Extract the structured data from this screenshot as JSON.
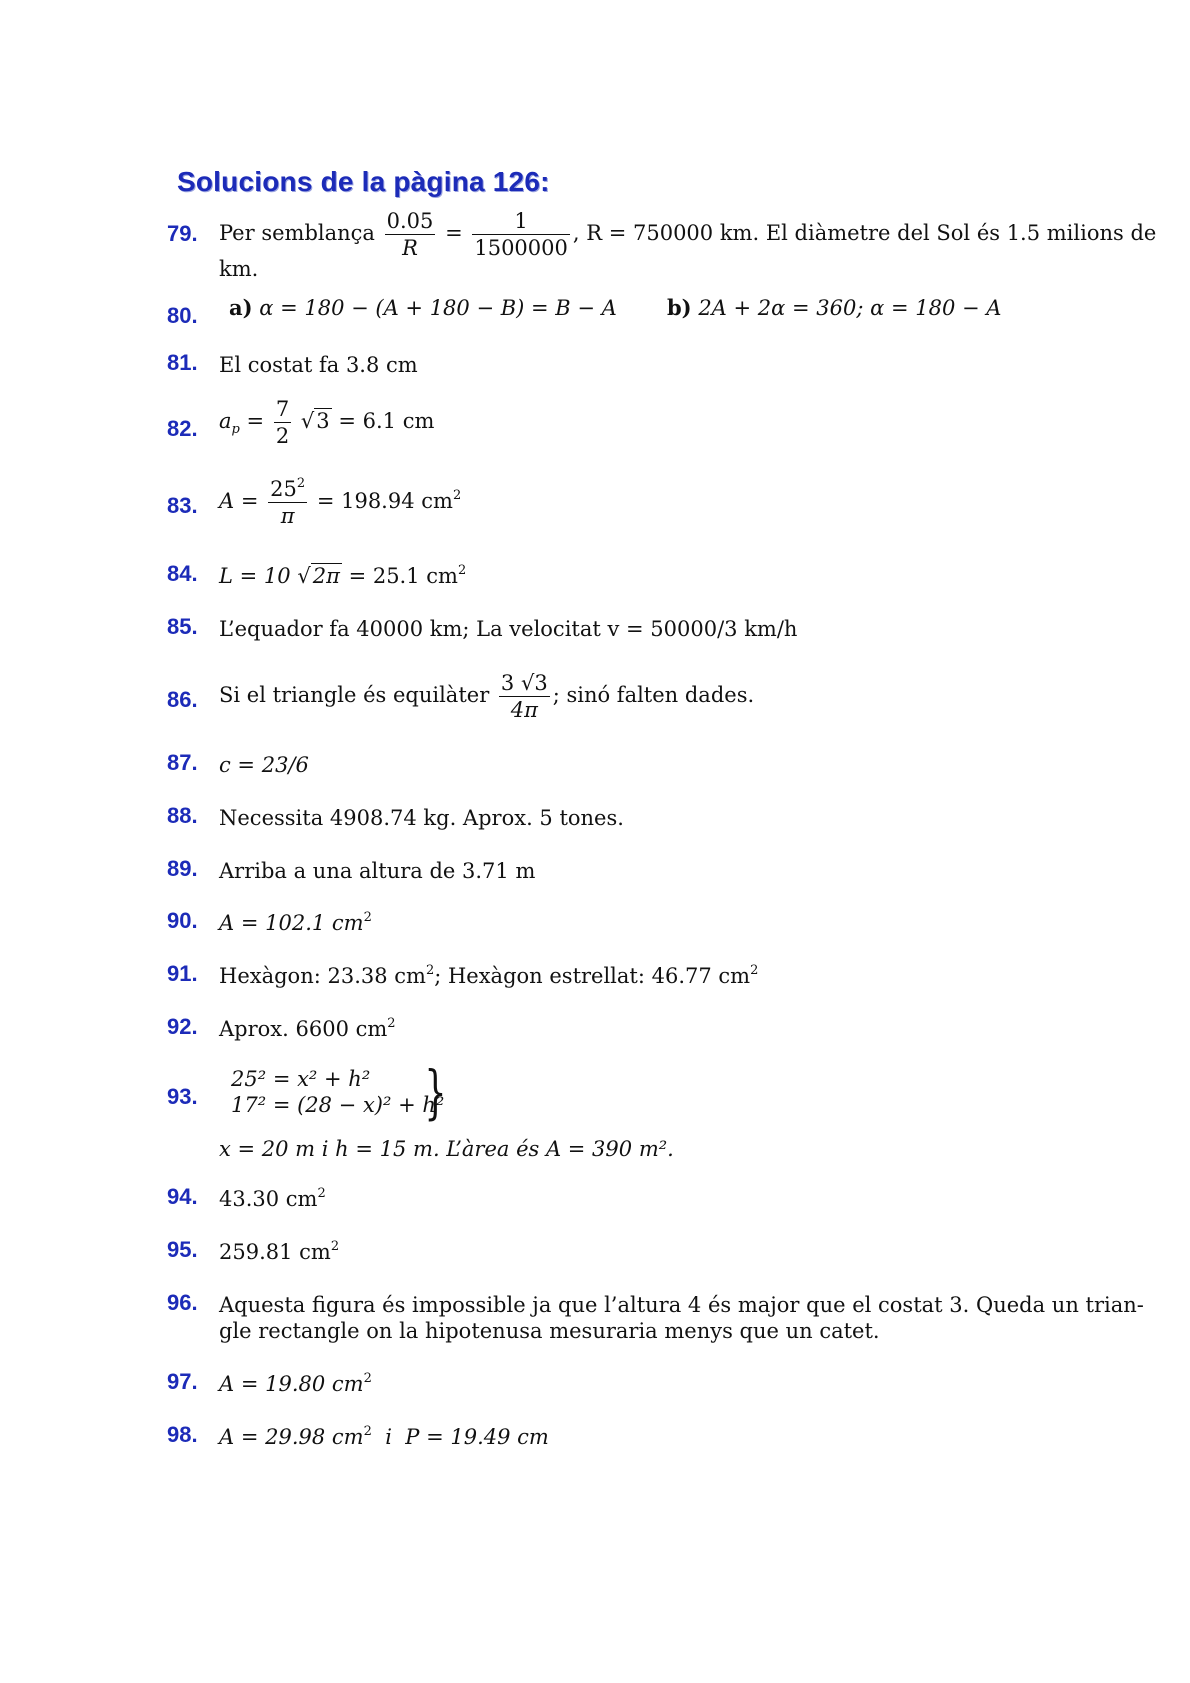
{
  "title": "Solucions de la pàgina 126:",
  "items": [
    {
      "n": "79."
    },
    {
      "n": "80."
    },
    {
      "n": "81."
    },
    {
      "n": "82."
    },
    {
      "n": "83."
    },
    {
      "n": "84."
    },
    {
      "n": "85."
    },
    {
      "n": "86."
    },
    {
      "n": "87."
    },
    {
      "n": "88."
    },
    {
      "n": "89."
    },
    {
      "n": "90."
    },
    {
      "n": "91."
    },
    {
      "n": "92."
    },
    {
      "n": "93."
    },
    {
      "n": "94."
    },
    {
      "n": "95."
    },
    {
      "n": "96."
    },
    {
      "n": "97."
    },
    {
      "n": "98."
    }
  ],
  "t": {
    "s79a": "Per semblança",
    "s79b": ", R = 750000 km. El diàmetre del Sol és 1.5 milions de",
    "s79c": "km.",
    "f79n1": "0.05",
    "f79d1": "R",
    "f79n2": "1",
    "f79d2": "1500000",
    "s80a_label": "a)",
    "s80a": "α = 180 − (A + 180 − B) = B − A",
    "s80b_label": "b)",
    "s80b": "2A + 2α = 360; α = 180 − A",
    "s81": "El costat fa 3.8 cm",
    "s82a": "a",
    "s82sub": "p",
    "s82eq": "=",
    "f82n": "7",
    "f82d": "2",
    "s82rad": "3",
    "s82b": "= 6.1 cm",
    "s83a": "A =",
    "f83n": "25",
    "f83sup": "2",
    "f83d": "π",
    "s83b": "= 198.94 cm",
    "s83sup": "2",
    "s84a": "L = 10",
    "s84rad": "2π",
    "s84b": "= 25.1 cm",
    "s84sup": "2",
    "s85": "L’equador fa 40000 km;  La velocitat v = 50000/3 km/h",
    "s86a": "Si el triangle és equilàter",
    "f86n": "3 √3",
    "f86d": "4π",
    "s86b": ";  sinó falten dades.",
    "s87": "c = 23/6",
    "s88": "Necessita 4908.74 kg. Aprox. 5 tones.",
    "s89": "Arriba a una altura de 3.71 m",
    "s90": "A = 102.1 cm",
    "s90sup": "2",
    "s91a": "Hexàgon: 23.38 cm",
    "s91sup1": "2",
    "s91b": ";  Hexàgon estrellat: 46.77 cm",
    "s91sup2": "2",
    "s92": "Aprox. 6600 cm",
    "s92sup": "2",
    "s93l1": "25² = x² + h²",
    "s93l2": "17² = (28 − x)² + h²",
    "s93brace": "}",
    "s93c": "x = 20 m   i   h = 15 m. L’àrea és A = 390 m².",
    "s94": "43.30 cm",
    "s94sup": "2",
    "s95": "259.81 cm",
    "s95sup": "2",
    "s96a": "Aquesta figura és impossible ja que l’altura 4 és major que el costat 3. Queda un trian-",
    "s96b": "gle rectangle on la hipotenusa mesuraria menys que un catet.",
    "s97": "A = 19.80 cm",
    "s97sup": "2",
    "s98a": "A = 29.98 cm",
    "s98sup": "2",
    "s98b": "  i  P = 19.49 cm"
  }
}
